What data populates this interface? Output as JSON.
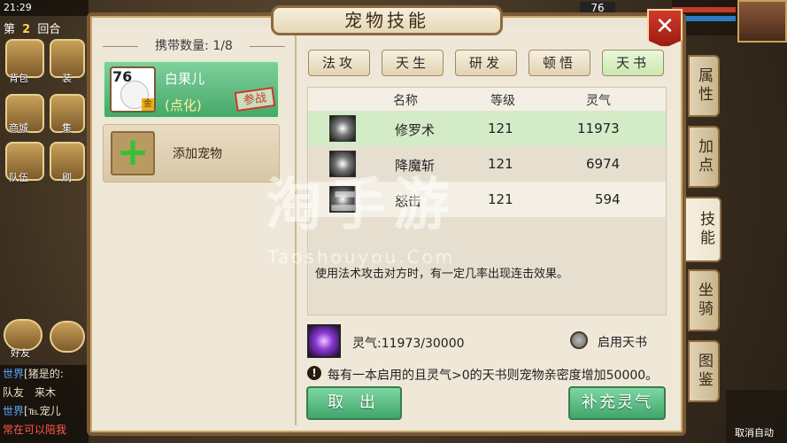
{
  "status": {
    "time": "21:29",
    "round_label": "第",
    "round_num": "2",
    "round_suffix": "回合"
  },
  "hud_left": {
    "items": [
      "背包",
      "商城",
      "队伍",
      "装",
      "集",
      "刷"
    ]
  },
  "friends_label": "好友",
  "chat": [
    {
      "channel": "世界",
      "text": "[猪是的:"
    },
    {
      "channel": "",
      "text": "队友　来木"
    },
    {
      "channel": "世界",
      "text": "[℡宠儿"
    },
    {
      "channel": "",
      "text": "常在可以陪我"
    }
  ],
  "right_hud": {
    "level": "76",
    "cancel_auto": "取消自动"
  },
  "title": "宠物技能",
  "close_label": "✕",
  "carry": {
    "label": "携带数量:",
    "count": "1/8"
  },
  "pet": {
    "level": "76",
    "grade": "金",
    "name": "白果儿",
    "sub": "(点化)",
    "badge": "参战"
  },
  "add_pet_label": "添加宠物",
  "tabs": [
    {
      "label": "法攻",
      "active": false
    },
    {
      "label": "天生",
      "active": false
    },
    {
      "label": "研发",
      "active": false
    },
    {
      "label": "顿悟",
      "active": false
    },
    {
      "label": "天书",
      "active": true
    }
  ],
  "table": {
    "headers": [
      "名称",
      "等级",
      "灵气"
    ],
    "rows": [
      {
        "name": "修罗术",
        "level": "121",
        "lingqi": "11973"
      },
      {
        "name": "降魔斩",
        "level": "121",
        "lingqi": "6974"
      },
      {
        "name": "怒击",
        "level": "121",
        "lingqi": "594"
      }
    ]
  },
  "description": "使用法术攻击对方时，有一定几率出现连击效果。",
  "watermark": {
    "main": "淘手游",
    "sub": "Taoshouyou.Com"
  },
  "lingqi": {
    "label": "灵气:11973/30000"
  },
  "enable_tianshu_label": "启用天书",
  "notice": "每有一本启用的且灵气>0的天书则宠物亲密度增加50000。",
  "buttons": {
    "take_out": "取 出",
    "refill": "补充灵气"
  },
  "side_tabs": [
    {
      "label": "属性",
      "active": false
    },
    {
      "label": "加点",
      "active": false
    },
    {
      "label": "技能",
      "active": true
    },
    {
      "label": "坐骑",
      "active": false
    },
    {
      "label": "图鉴",
      "active": false
    }
  ]
}
